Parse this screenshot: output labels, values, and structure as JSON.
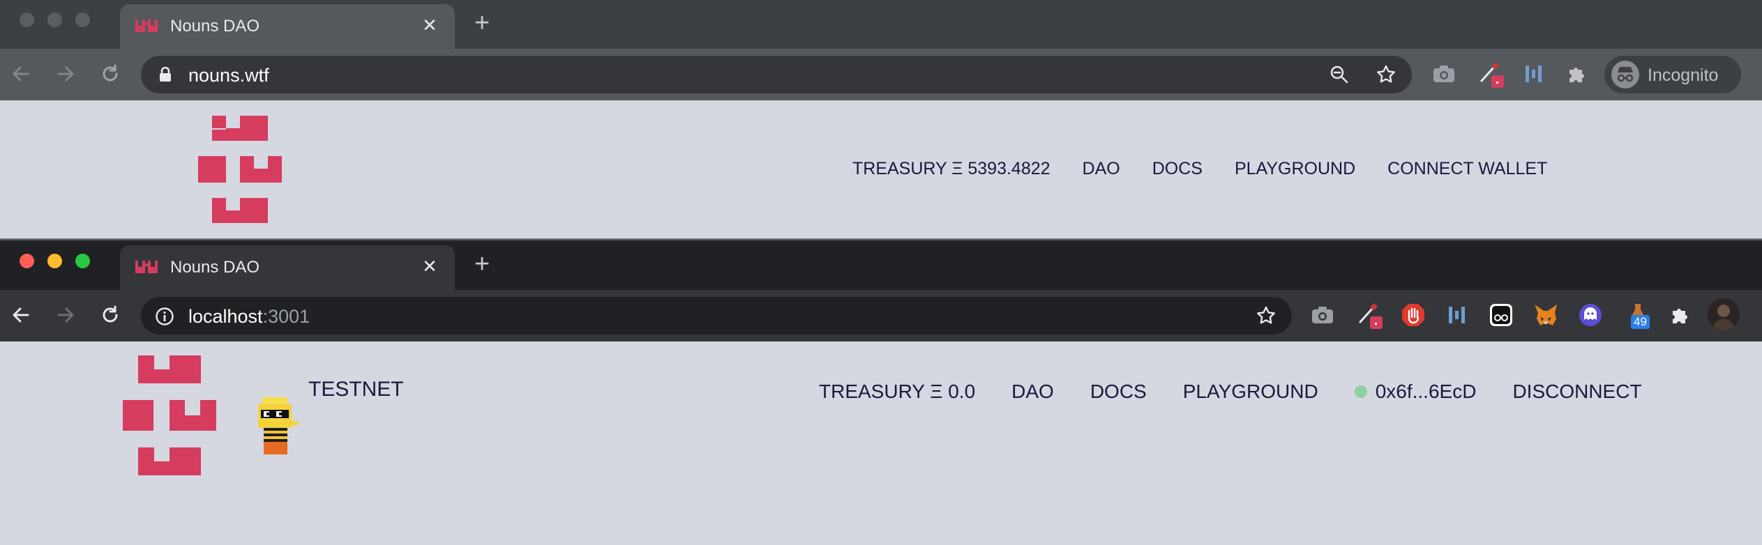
{
  "window1": {
    "tab_title": "Nouns DAO",
    "tab_close": "✕",
    "new_tab": "+",
    "url": "nouns.wtf",
    "profile_label": "Incognito",
    "nav": {
      "treasury": "TREASURY Ξ 5393.4822",
      "dao": "DAO",
      "docs": "DOCS",
      "playground": "PLAYGROUND",
      "wallet": "CONNECT WALLET"
    }
  },
  "window2": {
    "tab_title": "Nouns DAO",
    "tab_close": "✕",
    "new_tab": "+",
    "url_host": "localhost",
    "url_port": ":3001",
    "extension_badge": "49",
    "network_label": "TESTNET",
    "nav": {
      "treasury": "TREASURY Ξ 0.0",
      "dao": "DAO",
      "docs": "DOCS",
      "playground": "PLAYGROUND",
      "address": "0x6f...6EcD",
      "disconnect": "DISCONNECT"
    }
  },
  "colors": {
    "page_bg": "#d5d7e1",
    "logo_red": "#d63c5e",
    "nav_text": "#151c3b",
    "traffic_red": "#ff5f57",
    "traffic_yellow": "#febc2e",
    "traffic_green": "#28c840",
    "connected_dot": "#8fd19e"
  },
  "icons": [
    "back-arrow-icon",
    "forward-arrow-icon",
    "reload-icon",
    "lock-icon",
    "info-icon",
    "zoom-out-icon",
    "star-icon",
    "camera-icon",
    "pipette-icon",
    "stop-hand-icon",
    "bars-icon",
    "glasses-icon",
    "fox-icon",
    "ghost-icon",
    "puzzle-icon",
    "avatar-icon",
    "incognito-icon"
  ]
}
